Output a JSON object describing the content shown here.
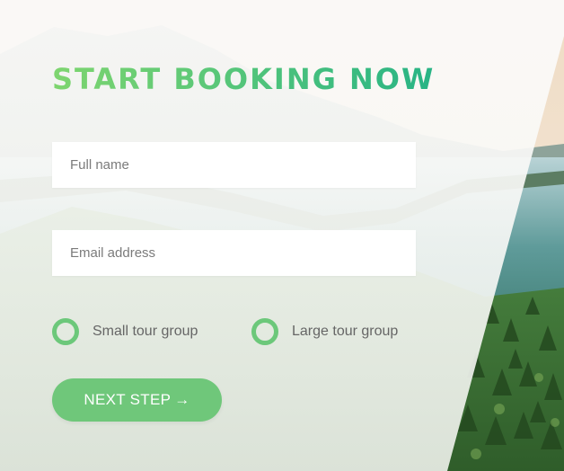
{
  "booking_form": {
    "title": "START BOOKING NOW",
    "fields": {
      "full_name": {
        "value": "",
        "placeholder": "Full name"
      },
      "email": {
        "value": "",
        "placeholder": "Email address"
      }
    },
    "tour_size": {
      "options": [
        {
          "label": "Small tour group",
          "selected": false
        },
        {
          "label": "Large tour group",
          "selected": false
        }
      ]
    },
    "next_button": {
      "label": "NEXT STEP",
      "arrow": "→"
    }
  },
  "colors": {
    "title_gradient_start": "#7ed56f",
    "title_gradient_end": "#28b485",
    "radio_ring": "#6cc87a",
    "button_bg": "#6fc77a",
    "button_text": "#ffffff"
  }
}
